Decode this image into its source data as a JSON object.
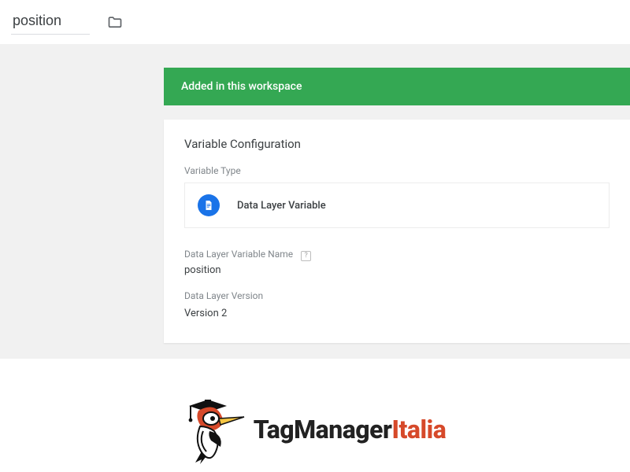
{
  "topbar": {
    "title_value": "position"
  },
  "banner": {
    "text": "Added in this workspace"
  },
  "card": {
    "title": "Variable Configuration",
    "type_label": "Variable Type",
    "type_name": "Data Layer Variable",
    "name_label": "Data Layer Variable Name",
    "name_value": "position",
    "help_symbol": "?",
    "version_label": "Data Layer Version",
    "version_value": "Version 2"
  },
  "branding": {
    "part1": "TagManager",
    "part2": "Italia"
  }
}
